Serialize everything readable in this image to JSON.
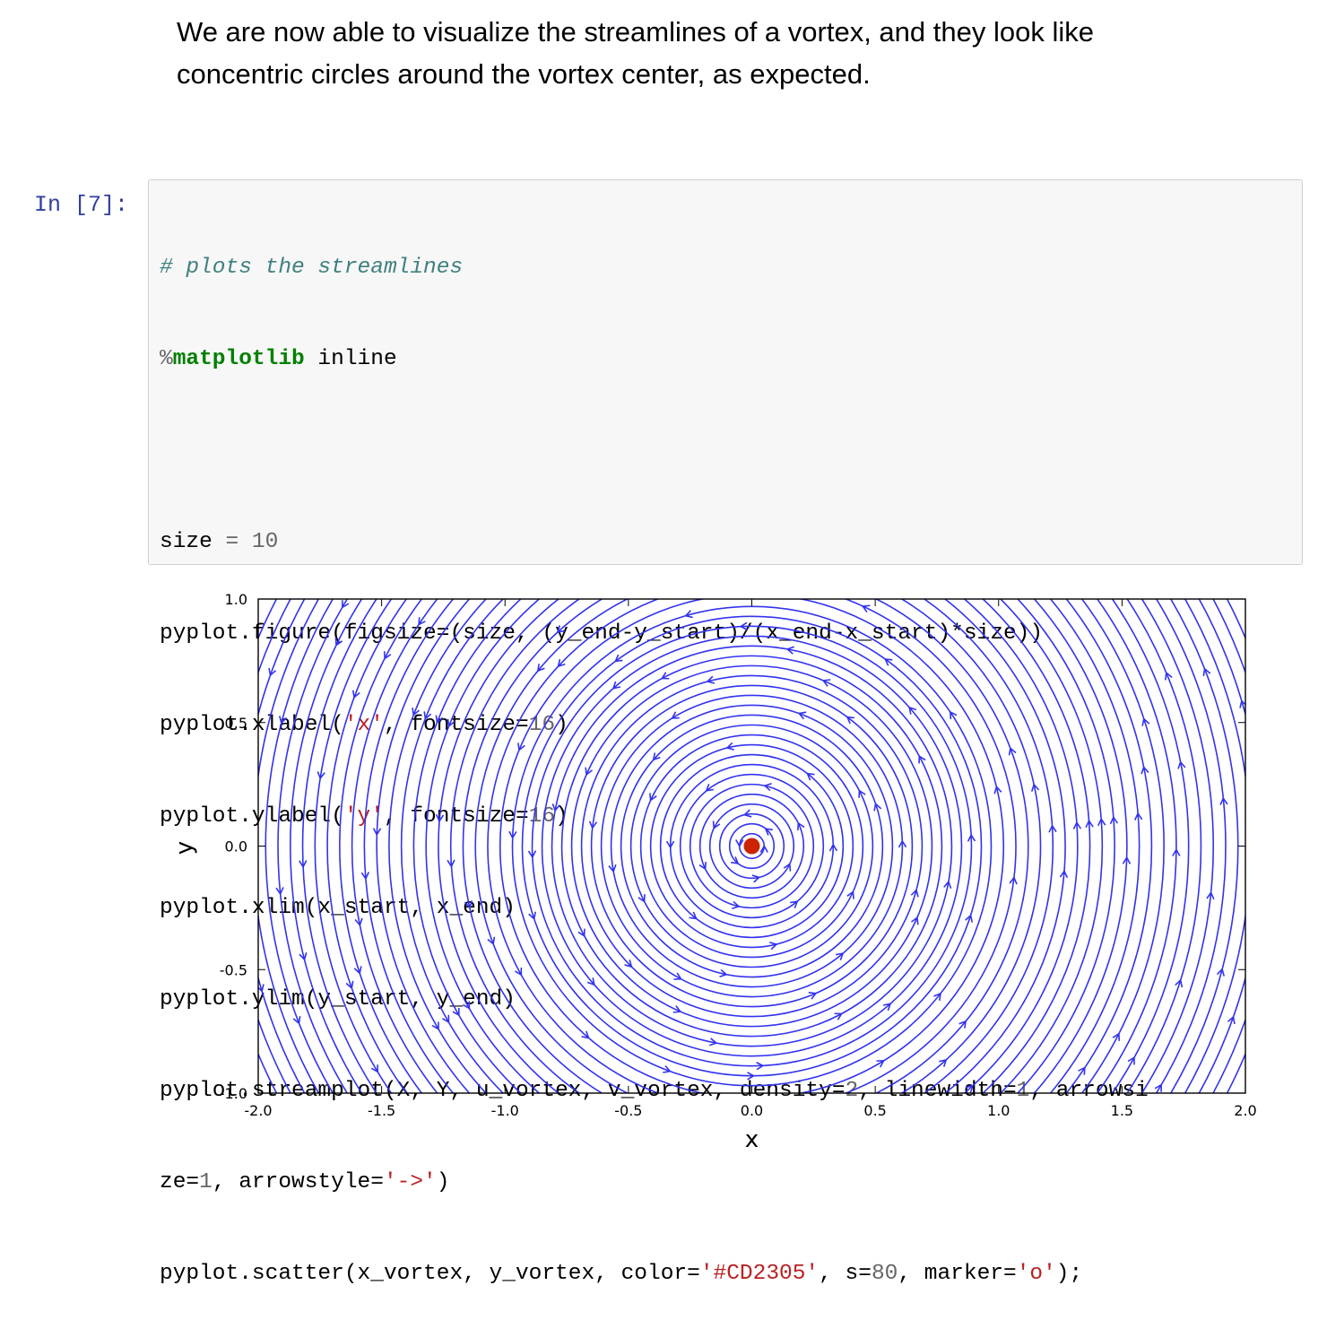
{
  "markdown": {
    "line1": "We are now able to visualize the streamlines of a vortex, and they look like",
    "line2": "concentric circles around the vortex center, as expected."
  },
  "cell": {
    "prompt": "In [7]:",
    "code": {
      "l1_comment": "# plots the streamlines",
      "l2_magic_pct": "%",
      "l2_magic_kw": "matplotlib",
      "l2_rest": " inline",
      "l4_a": "size ",
      "l4_op": "=",
      "l4_num": " 10",
      "l5": "pyplot.figure(figsize=(size, (y_end-y_start)/(x_end-x_start)*size))",
      "l6_a": "pyplot.xlabel(",
      "l6_str": "'x'",
      "l6_b": ", fontsize=",
      "l6_num": "16",
      "l6_c": ")",
      "l7_a": "pyplot.ylabel(",
      "l7_str": "'y'",
      "l7_b": ", fontsize=",
      "l7_num": "16",
      "l7_c": ")",
      "l8": "pyplot.xlim(x_start, x_end)",
      "l9": "pyplot.ylim(y_start, y_end)",
      "l10_a": "pyplot.streamplot(X, Y, u_vortex, v_vortex, density=",
      "l10_n1": "2",
      "l10_b": ", linewidth=",
      "l10_n2": "1",
      "l10_c": ", arrowsi",
      "l11_a": "ze=",
      "l11_n": "1",
      "l11_b": ", arrowstyle=",
      "l11_str": "'->'",
      "l11_c": ")",
      "l12_a": "pyplot.scatter(x_vortex, y_vortex, color=",
      "l12_str": "'#CD2305'",
      "l12_b": ", s=",
      "l12_n": "80",
      "l12_c": ", marker=",
      "l12_str2": "'o'",
      "l12_d": ");"
    }
  },
  "chart_data": {
    "type": "streamplot",
    "xlabel": "x",
    "ylabel": "y",
    "xlim": [
      -2.0,
      2.0
    ],
    "ylim": [
      -1.0,
      1.0
    ],
    "xticks": [
      "-2.0",
      "-1.5",
      "-1.0",
      "-0.5",
      "0.0",
      "0.5",
      "1.0",
      "1.5",
      "2.0"
    ],
    "yticks": [
      "-1.0",
      "-0.5",
      "0.0",
      "0.5",
      "1.0"
    ],
    "xtick_values": [
      -2.0,
      -1.5,
      -1.0,
      -0.5,
      0.0,
      0.5,
      1.0,
      1.5,
      2.0
    ],
    "ytick_values": [
      -1.0,
      -0.5,
      0.0,
      0.5,
      1.0
    ],
    "vortex": {
      "x": 0.0,
      "y": 0.0,
      "color": "#CD2305"
    },
    "stream_color": "#3333ee",
    "rotation": "counterclockwise",
    "radii": [
      0.05,
      0.09,
      0.13,
      0.17,
      0.21,
      0.25,
      0.29,
      0.33,
      0.37,
      0.41,
      0.45,
      0.49,
      0.53,
      0.57,
      0.61,
      0.65,
      0.69,
      0.73,
      0.77,
      0.81,
      0.85,
      0.89,
      0.93,
      0.97,
      1.02,
      1.07,
      1.12,
      1.17,
      1.22,
      1.27,
      1.32,
      1.37,
      1.42,
      1.47,
      1.52,
      1.57,
      1.62,
      1.67,
      1.72,
      1.77,
      1.82,
      1.87,
      1.92,
      1.97,
      2.02,
      2.07,
      2.12,
      2.17
    ]
  }
}
